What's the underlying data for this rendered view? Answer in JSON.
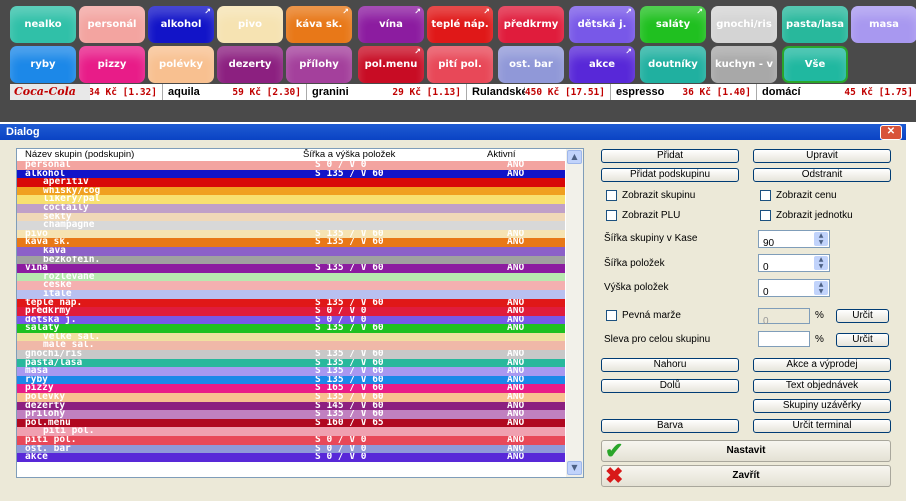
{
  "categories": [
    {
      "label": "nealko",
      "color": "#30c0a8",
      "arrow": false
    },
    {
      "label": "personál",
      "color": "#f3a4a0",
      "arrow": false
    },
    {
      "label": "alkohol",
      "color": "#1214c8",
      "arrow": true
    },
    {
      "label": "pivo",
      "color": "#f6e3b2",
      "arrow": false
    },
    {
      "label": "káva sk.",
      "color": "#e87818",
      "arrow": true
    },
    {
      "label": "vína",
      "color": "#8c1ca0",
      "arrow": true
    },
    {
      "label": "teplé náp.",
      "color": "#e01818",
      "arrow": true
    },
    {
      "label": "předkrmy",
      "color": "#e01c3c",
      "arrow": false
    },
    {
      "label": "dětská j.",
      "color": "#7858e8",
      "arrow": true
    },
    {
      "label": "saláty",
      "color": "#20c020",
      "arrow": true
    },
    {
      "label": "gnochi/ris",
      "color": "#d4d4d4",
      "arrow": false
    },
    {
      "label": "pasta/lasa",
      "color": "#28b89c",
      "arrow": false
    },
    {
      "label": "masa",
      "color": "#a898f0",
      "arrow": false
    },
    {
      "label": "ryby",
      "color": "#1c88e8",
      "arrow": false
    },
    {
      "label": "pizzy",
      "color": "#e81c88",
      "arrow": false
    },
    {
      "label": "polévky",
      "color": "#f8c090",
      "arrow": false
    },
    {
      "label": "dezerty",
      "color": "#8c2080",
      "arrow": false
    },
    {
      "label": "přílohy",
      "color": "#a4409c",
      "arrow": false
    },
    {
      "label": "pol.menu",
      "color": "#c80c24",
      "arrow": true
    },
    {
      "label": "pití pol.",
      "color": "#e84858",
      "arrow": false
    },
    {
      "label": "ost. bar",
      "color": "#9098d8",
      "arrow": false
    },
    {
      "label": "akce",
      "color": "#5828d8",
      "arrow": true
    },
    {
      "label": "doutníky",
      "color": "#20b0a0",
      "arrow": false
    },
    {
      "label": "kuchyn - v",
      "color": "#a8a8a8",
      "arrow": false
    },
    {
      "label": "Vše",
      "color": "#20b8a0",
      "arrow": false
    }
  ],
  "products": [
    {
      "name": "",
      "price": "34 Kč [1.32]"
    },
    {
      "name": "aquila",
      "price": "59 Kč [2.30]"
    },
    {
      "name": "granini",
      "price": "29 Kč [1.13]"
    },
    {
      "name": "Rulandské",
      "price": "450 Kč [17.51]"
    },
    {
      "name": "espresso",
      "price": "36 Kč [1.40]"
    },
    {
      "name": "domácí",
      "price": "45 Kč [1.75]"
    }
  ],
  "dialog": {
    "title": "Dialog",
    "columns": {
      "name": "Název skupin (podskupin)",
      "size": "Šířka a výška položek",
      "active": "Aktivní"
    },
    "rows": [
      {
        "name": "personál",
        "size": "Š 0 / V 0",
        "active": "ANO",
        "bg": "#f3a4a0",
        "indent": false
      },
      {
        "name": "alkohol",
        "size": "Š 135 / V 60",
        "active": "ANO",
        "bg": "#1214c8",
        "indent": false
      },
      {
        "name": "aperitiv",
        "size": "",
        "active": "",
        "bg": "#d80808",
        "indent": true
      },
      {
        "name": "whisky/cog",
        "size": "",
        "active": "",
        "bg": "#f0a020",
        "indent": true
      },
      {
        "name": "likéry/pál",
        "size": "",
        "active": "",
        "bg": "#f8e070",
        "indent": true
      },
      {
        "name": "coctaily",
        "size": "",
        "active": "",
        "bg": "#c0a0c8",
        "indent": true
      },
      {
        "name": "sekty",
        "size": "",
        "active": "",
        "bg": "#f0d8b8",
        "indent": true
      },
      {
        "name": "champagne",
        "size": "",
        "active": "",
        "bg": "#d8d8d8",
        "indent": true
      },
      {
        "name": "pivo",
        "size": "Š 135 / V 60",
        "active": "ANO",
        "bg": "#f6e3b2",
        "indent": false
      },
      {
        "name": "káva sk.",
        "size": "Š 135 / V 60",
        "active": "ANO",
        "bg": "#e87818",
        "indent": false
      },
      {
        "name": "káva",
        "size": "",
        "active": "",
        "bg": "#8c60c8",
        "indent": true
      },
      {
        "name": "bezkofein.",
        "size": "",
        "active": "",
        "bg": "#a0a0a0",
        "indent": true
      },
      {
        "name": "vína",
        "size": "Š 135 / V 60",
        "active": "ANO",
        "bg": "#8c1ca0",
        "indent": false
      },
      {
        "name": "rozlévané",
        "size": "",
        "active": "",
        "bg": "#b8e8b0",
        "indent": true
      },
      {
        "name": "české",
        "size": "",
        "active": "",
        "bg": "#f4b0b0",
        "indent": true
      },
      {
        "name": "itále",
        "size": "",
        "active": "",
        "bg": "#b8c0f0",
        "indent": true
      },
      {
        "name": "teplé náp.",
        "size": "Š 135 / V 60",
        "active": "ANO",
        "bg": "#e01818",
        "indent": false
      },
      {
        "name": "předkrmy",
        "size": "Š 0 / V 0",
        "active": "ANO",
        "bg": "#e01c3c",
        "indent": false
      },
      {
        "name": "dětská j.",
        "size": "Š 0 / V 0",
        "active": "ANO",
        "bg": "#7858e8",
        "indent": false
      },
      {
        "name": "saláty",
        "size": "Š 135 / V 60",
        "active": "ANO",
        "bg": "#20c020",
        "indent": false
      },
      {
        "name": "velké sal.",
        "size": "",
        "active": "",
        "bg": "#f0e0a0",
        "indent": true
      },
      {
        "name": "malé sal.",
        "size": "",
        "active": "",
        "bg": "#f0b8a8",
        "indent": true
      },
      {
        "name": "gnochi/ris",
        "size": "Š 135 / V 60",
        "active": "ANO",
        "bg": "#c8c8c8",
        "indent": false
      },
      {
        "name": "pasta/lasa",
        "size": "Š 135 / V 60",
        "active": "ANO",
        "bg": "#28b89c",
        "indent": false
      },
      {
        "name": "masa",
        "size": "Š 135 / V 60",
        "active": "ANO",
        "bg": "#a898f0",
        "indent": false
      },
      {
        "name": "ryby",
        "size": "Š 135 / V 60",
        "active": "ANO",
        "bg": "#1c88e8",
        "indent": false
      },
      {
        "name": "pizzy",
        "size": "Š 165 / V 60",
        "active": "ANO",
        "bg": "#e81c88",
        "indent": false
      },
      {
        "name": "polévky",
        "size": "Š 135 / V 60",
        "active": "ANO",
        "bg": "#f8c090",
        "indent": false
      },
      {
        "name": "dezerty",
        "size": "Š 145 / V 60",
        "active": "ANO",
        "bg": "#8c2080",
        "indent": false
      },
      {
        "name": "přílohy",
        "size": "Š 135 / V 60",
        "active": "ANO",
        "bg": "#c080c0",
        "indent": false
      },
      {
        "name": "pol.menu",
        "size": "Š 160 / V 65",
        "active": "ANO",
        "bg": "#b00820",
        "indent": false
      },
      {
        "name": "pití pol.",
        "size": "",
        "active": "",
        "bg": "#f0a0b0",
        "indent": true
      },
      {
        "name": "pití pol.",
        "size": "Š 0 / V 0",
        "active": "ANO",
        "bg": "#e84858",
        "indent": false
      },
      {
        "name": "ost. bar",
        "size": "Š 0 / V 0",
        "active": "ANO",
        "bg": "#9098d8",
        "indent": false
      },
      {
        "name": "akce",
        "size": "Š 0 / V 0",
        "active": "ANO",
        "bg": "#5828d8",
        "indent": false
      }
    ],
    "buttons": {
      "add": "Přidat",
      "edit": "Upravit",
      "add_sub": "Přidat podskupinu",
      "remove": "Odstranit",
      "up": "Nahoru",
      "down": "Dolů",
      "promo": "Akce a výprodej",
      "order_text": "Text objednávek",
      "closing_groups": "Skupiny uzávěrky",
      "color": "Barva",
      "terminal": "Určit terminal",
      "set": "Nastavit",
      "close": "Zavřít",
      "determine1": "Určit",
      "determine2": "Určit"
    },
    "checkboxes": {
      "show_group": "Zobrazit skupinu",
      "show_price": "Zobrazit cenu",
      "show_plu": "Zobrazit PLU",
      "show_unit": "Zobrazit jednotku",
      "fixed_margin": "Pevná marže"
    },
    "fields": {
      "group_width_label": "Šířka skupiny v Kase",
      "group_width_value": "90",
      "item_width_label": "Šířka položek",
      "item_width_value": "0",
      "item_height_label": "Výška položek",
      "item_height_value": "0",
      "margin_value": "0",
      "discount_label": "Sleva pro celou skupinu",
      "discount_value": "",
      "percent1": "%",
      "percent2": "%"
    },
    "colors": {
      "set_icon": "#2aa52a",
      "close_icon": "#d81818"
    }
  }
}
